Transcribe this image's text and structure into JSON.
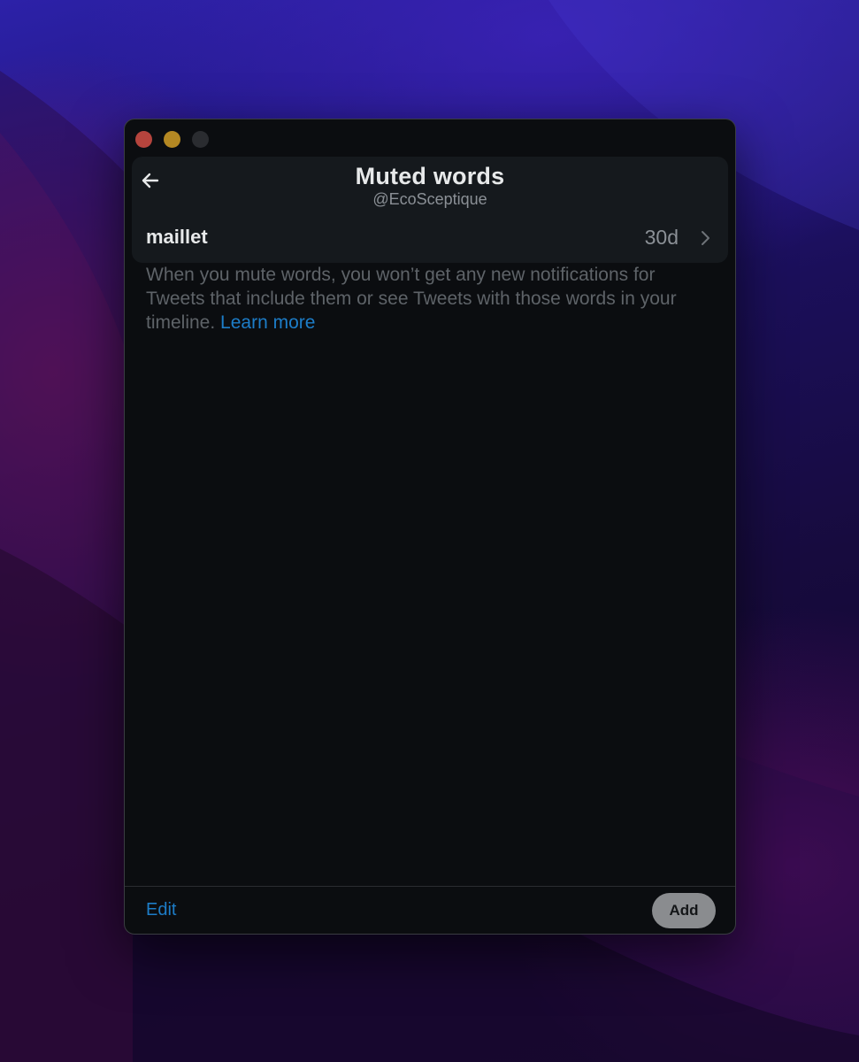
{
  "window": {
    "controls": [
      "close",
      "minimize",
      "zoom"
    ]
  },
  "header": {
    "back_icon": "arrow-left-icon",
    "title": "Muted words",
    "subtitle": "@EcoSceptique"
  },
  "muted_words": [
    {
      "word": "maillet",
      "duration": "30d",
      "icon": "chevron-right-icon"
    }
  ],
  "info": {
    "text": "When you mute words, you won’t get any new notifications for Tweets that include them or see Tweets with those words in your timeline.",
    "link_label": "Learn more"
  },
  "footer": {
    "edit_label": "Edit",
    "add_label": "Add"
  },
  "colors": {
    "accent_link": "#1d7dc8",
    "window_bg": "#0b0d10",
    "card_bg": "#15191d",
    "close": "#b5443d",
    "minimize": "#b48823",
    "zoom_inactive": "#2a2c30"
  }
}
